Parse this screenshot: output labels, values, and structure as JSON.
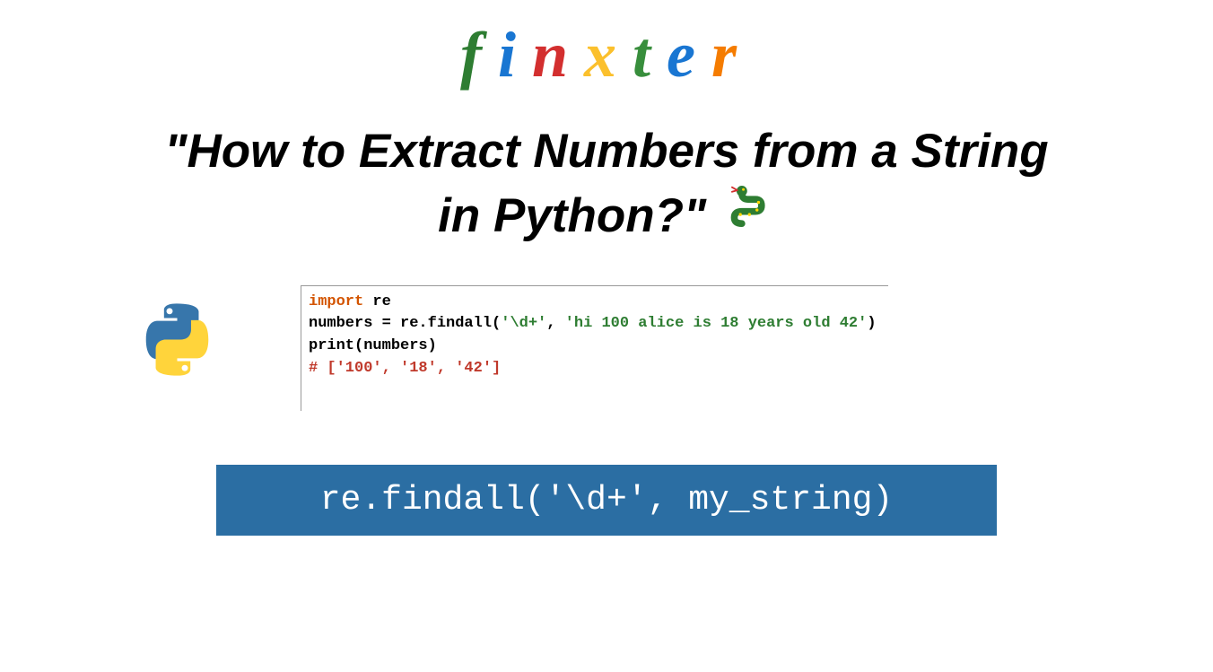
{
  "logo": {
    "f": "f",
    "i": "i",
    "n": "n",
    "x": "x",
    "t": "t",
    "e": "e",
    "r": "r"
  },
  "title": {
    "line1": "\"How to Extract Numbers from a String",
    "line2": "in Python?\"",
    "emoji": "🐍"
  },
  "code": {
    "line1_kw": "import",
    "line1_mod": " re",
    "line2_a": "numbers = re.findall(",
    "line2_str1": "'\\d+'",
    "line2_b": ", ",
    "line2_str2": "'hi 100 alice is 18 years old 42'",
    "line2_c": ")",
    "line3": "print(numbers)",
    "line4": "# ['100', '18', '42']"
  },
  "summary": "re.findall('\\d+', my_string)",
  "colors": {
    "summary_bg": "#2B6EA3",
    "keyword": "#D35400",
    "string": "#2E7D32",
    "comment": "#C0392B"
  }
}
